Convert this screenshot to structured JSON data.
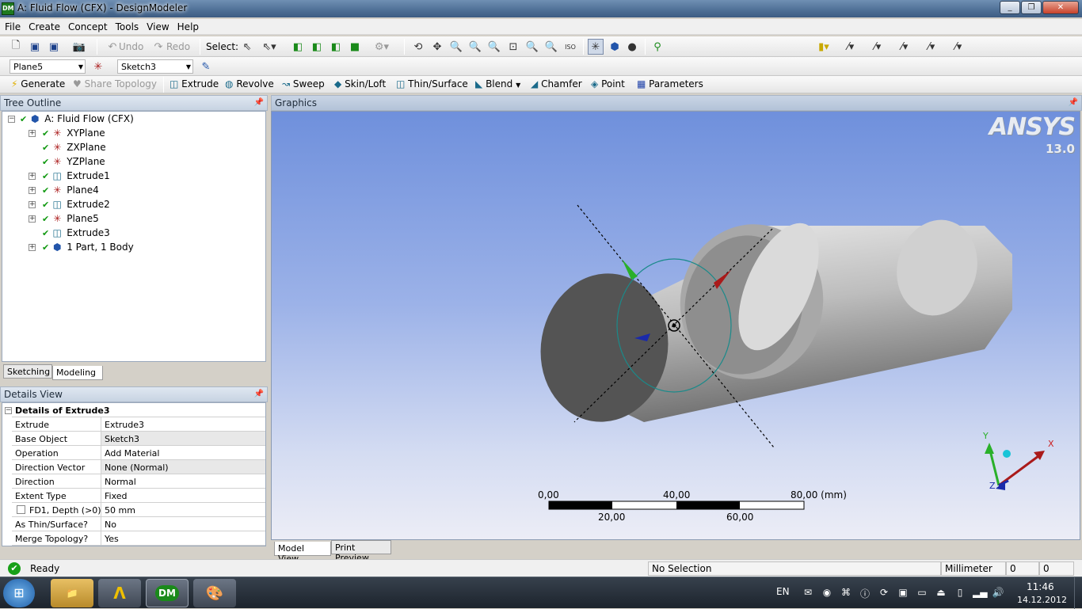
{
  "window": {
    "title": "A: Fluid Flow (CFX) - DesignModeler",
    "app_icon": "DM"
  },
  "menu": [
    "File",
    "Create",
    "Concept",
    "Tools",
    "View",
    "Help"
  ],
  "toolbar1": {
    "undo": "Undo",
    "redo": "Redo",
    "select": "Select:"
  },
  "toolbar2": {
    "plane_combo": "Plane5",
    "sketch_combo": "Sketch3"
  },
  "toolbar3": {
    "generate": "Generate",
    "share_topology": "Share Topology",
    "extrude": "Extrude",
    "revolve": "Revolve",
    "sweep": "Sweep",
    "skin_loft": "Skin/Loft",
    "thin_surface": "Thin/Surface",
    "blend": "Blend",
    "chamfer": "Chamfer",
    "point": "Point",
    "parameters": "Parameters"
  },
  "tree": {
    "header": "Tree Outline",
    "root": "A: Fluid Flow (CFX)",
    "items": [
      "XYPlane",
      "ZXPlane",
      "YZPlane",
      "Extrude1",
      "Plane4",
      "Extrude2",
      "Plane5",
      "Extrude3",
      "1 Part, 1 Body"
    ],
    "tabs": [
      "Sketching",
      "Modeling"
    ]
  },
  "details": {
    "header": "Details View",
    "title": "Details of Extrude3",
    "rows": [
      {
        "k": "Extrude",
        "v": "Extrude3"
      },
      {
        "k": "Base Object",
        "v": "Sketch3"
      },
      {
        "k": "Operation",
        "v": "Add Material"
      },
      {
        "k": "Direction Vector",
        "v": "None (Normal)"
      },
      {
        "k": "Direction",
        "v": "Normal"
      },
      {
        "k": "Extent Type",
        "v": "Fixed"
      },
      {
        "k": "FD1,  Depth (>0)",
        "v": "50 mm"
      },
      {
        "k": "As Thin/Surface?",
        "v": "No"
      },
      {
        "k": "Merge Topology?",
        "v": "Yes"
      }
    ]
  },
  "graphics": {
    "header": "Graphics",
    "logo": "ANSYS",
    "version": "13.0",
    "scale_top": [
      "0,00",
      "40,00",
      "80,00 (mm)"
    ],
    "scale_bottom": [
      "20,00",
      "60,00"
    ],
    "triad": {
      "x": "X",
      "y": "Y",
      "z": "Z"
    },
    "tabs": [
      "Model View",
      "Print Preview"
    ]
  },
  "status": {
    "state": "Ready",
    "selection": "No Selection",
    "units": "Millimeter",
    "v1": "0",
    "v2": "0"
  },
  "taskbar": {
    "lang": "EN",
    "time": "11:46",
    "date": "14.12.2012",
    "apps": [
      "DM"
    ]
  }
}
